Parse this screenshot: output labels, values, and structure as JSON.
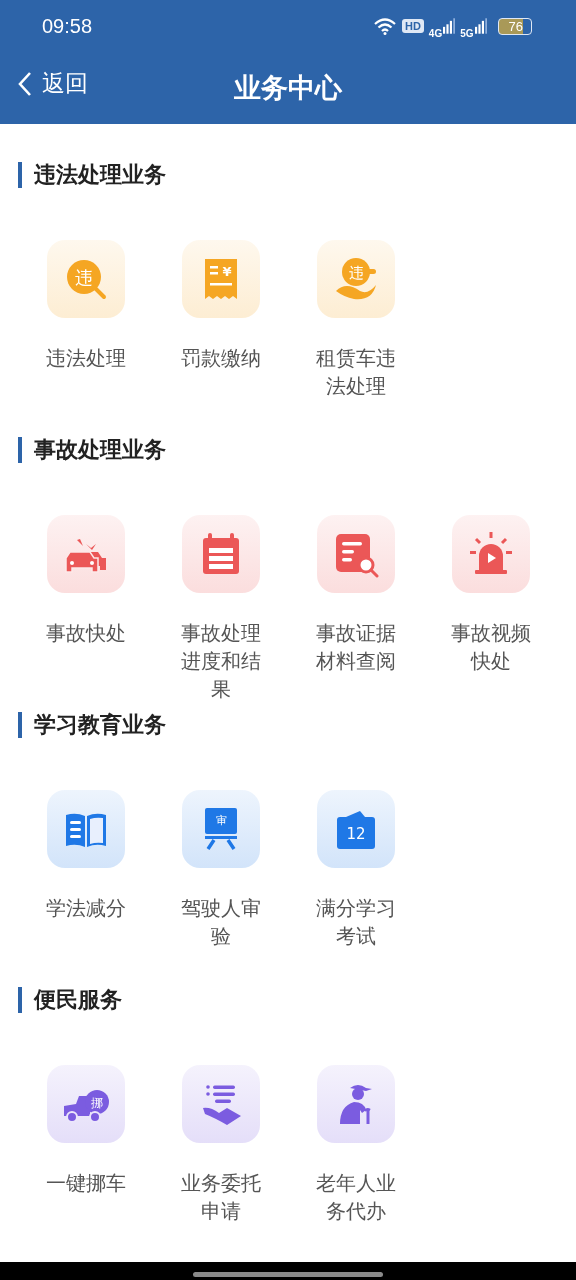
{
  "status_bar": {
    "time": "09:58",
    "hd": "HD",
    "net1": "4G",
    "net2": "5G",
    "battery": "76"
  },
  "nav": {
    "back": "返回",
    "title": "业务中心"
  },
  "sections": [
    {
      "title": "违法处理业务",
      "color": "#f5a623",
      "items": [
        {
          "label": "违法处理",
          "kind": "search-badge",
          "glyph": "违"
        },
        {
          "label": "罚款缴纳",
          "kind": "receipt",
          "glyph": "¥"
        },
        {
          "label": "租赁车违法处理",
          "kind": "hand-badge",
          "glyph": "违"
        }
      ]
    },
    {
      "title": "事故处理业务",
      "color": "#eb5757",
      "items": [
        {
          "label": "事故快处",
          "kind": "cars"
        },
        {
          "label": "事故处理进度和结果",
          "kind": "calendar"
        },
        {
          "label": "事故证据材料查阅",
          "kind": "doc-search"
        },
        {
          "label": "事故视频快处",
          "kind": "alarm"
        }
      ]
    },
    {
      "title": "学习教育业务",
      "color": "#1f78e6",
      "items": [
        {
          "label": "学法减分",
          "kind": "book"
        },
        {
          "label": "驾驶人审验",
          "kind": "easel",
          "glyph": "审"
        },
        {
          "label": "满分学习考试",
          "kind": "card",
          "glyph": "12"
        }
      ]
    },
    {
      "title": "便民服务",
      "color": "#7b5ce0",
      "items": [
        {
          "label": "一键挪车",
          "kind": "truck",
          "glyph": "挪"
        },
        {
          "label": "业务委托申请",
          "kind": "list-hand"
        },
        {
          "label": "老年人业务代办",
          "kind": "elder"
        }
      ]
    }
  ]
}
